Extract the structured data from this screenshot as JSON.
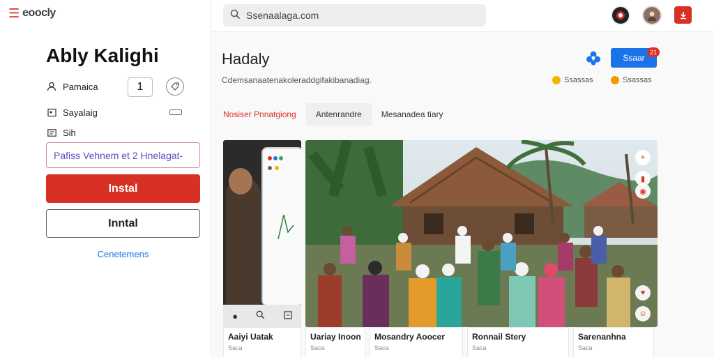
{
  "app": {
    "logo_text": "eoocly",
    "title": "Ably Kalighi"
  },
  "details": {
    "row1_label": "Pamaica",
    "stepper_value": "1",
    "row2_label": "Sayalaig",
    "row3_label": "Sih"
  },
  "promo": {
    "value": "Pafiss Vehnem et 2 Hnelagat-"
  },
  "buttons": {
    "install": "Instal",
    "install_secondary": "Inntal",
    "link": "Cenetemens"
  },
  "search": {
    "value": "Ssenaalaga.com"
  },
  "section": {
    "title": "Hadaly",
    "description": "Cdemsanaatenakoleraddgifakibanadiag.",
    "action_label": "Ssaar",
    "badge_count": "21",
    "stat1": "Ssassas",
    "stat2": "Ssassas"
  },
  "tabs": [
    {
      "label": "Nosiser Pnnatgiong"
    },
    {
      "label": "Antenrandre"
    },
    {
      "label": "Mesanadea tiary"
    }
  ],
  "cards": [
    {
      "title": "Aaiyi Uatak",
      "sub": "Saca"
    },
    {
      "title": "Uariay Inoona",
      "sub": "Saca"
    },
    {
      "title": "Mosandry Aoocer",
      "sub": "Saca"
    },
    {
      "title": "Ronnail Stery",
      "sub": "Saca"
    },
    {
      "title": "Sarenanhna",
      "sub": "Saca"
    }
  ],
  "colors": {
    "accent_red": "#d93025",
    "accent_blue": "#1a73e8"
  },
  "icons": [
    "menu-icon",
    "user-icon",
    "tag-icon",
    "calendar-icon",
    "card-icon",
    "search-icon",
    "share-icon",
    "apps-icon",
    "zoom-icon"
  ]
}
